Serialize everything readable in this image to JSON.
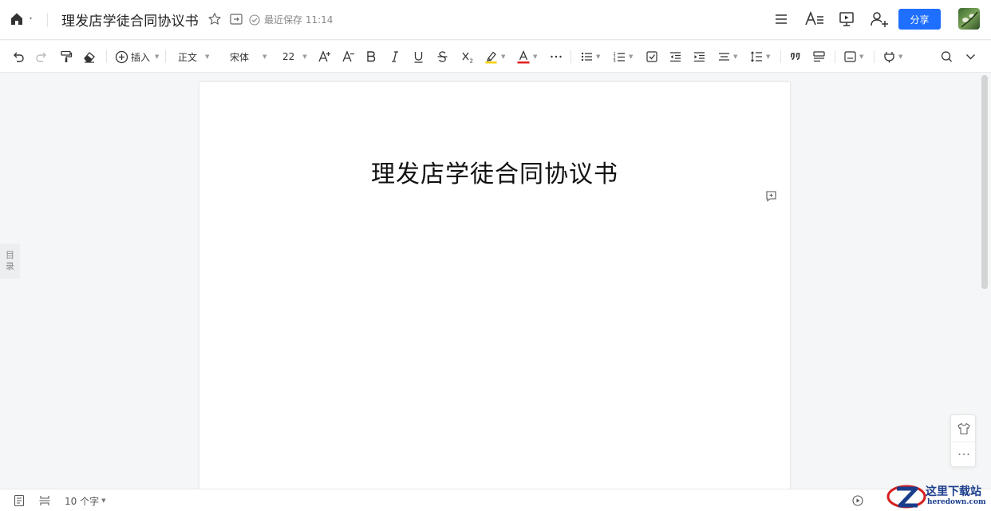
{
  "titlebar": {
    "doc_title": "理发店学徒合同协议书",
    "save_status": "最近保存 11:14",
    "share_label": "分享"
  },
  "toolbar": {
    "insert_label": "插入",
    "style_label": "正文",
    "font_label": "宋体",
    "size_label": "22"
  },
  "document": {
    "heading": "理发店学徒合同协议书"
  },
  "toc": {
    "line1": "目",
    "line2": "录"
  },
  "statusbar": {
    "word_count": "10 个字"
  },
  "watermark": {
    "site": "这里下载站",
    "url": "heredown.com"
  },
  "colors": {
    "accent": "#1f6fff",
    "highlight": "#f5d20a",
    "font_color": "#e02020"
  }
}
